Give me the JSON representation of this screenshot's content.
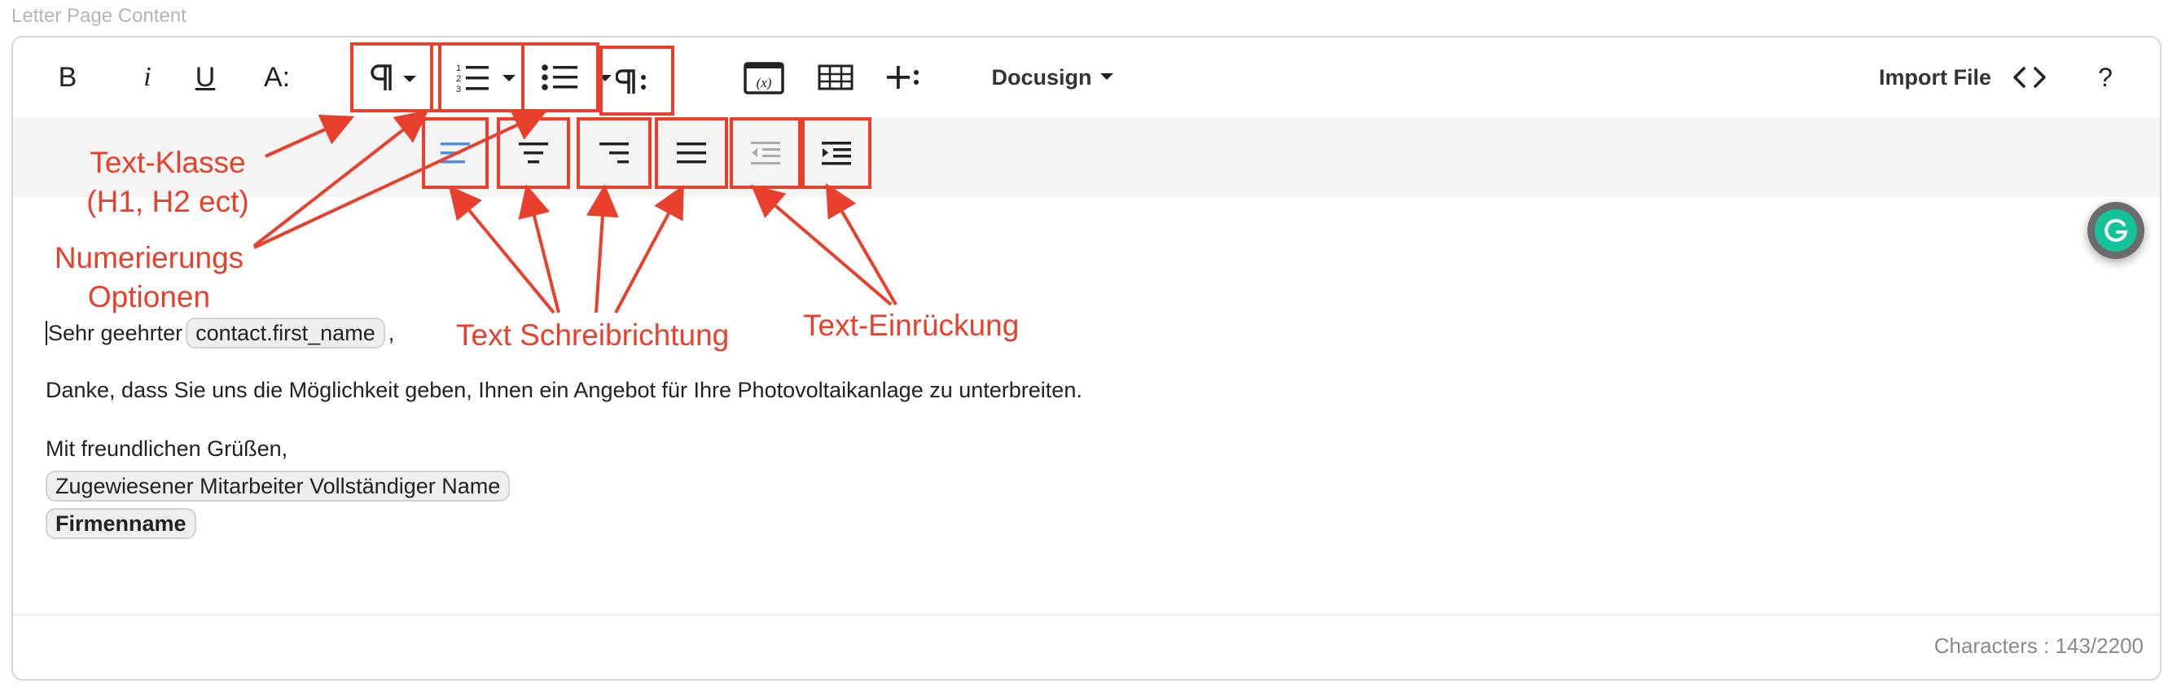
{
  "field": {
    "label": "Letter Page Content"
  },
  "toolbar": {
    "bold": "B",
    "italic": "i",
    "underline": "U",
    "font_size": "A:",
    "docusign": "Docusign",
    "import_file": "Import File",
    "help": "?"
  },
  "body": {
    "greeting": "Sehr geehrter",
    "greeting_var": "contact.first_name",
    "greeting_suffix": ",",
    "paragraph": "Danke, dass Sie uns die Möglichkeit geben, Ihnen ein Angebot für Ihre Photovoltaikanlage zu unterbreiten.",
    "closing": "Mit freundlichen Grüßen,",
    "employee_var": "Zugewiesener Mitarbeiter Vollständiger Name",
    "company_var": "Firmenname"
  },
  "footer": {
    "characters": "Characters : 143/2200"
  },
  "annotations": {
    "text_class_1": "Text-Klasse",
    "text_class_2": "(H1, H2 ect)",
    "numbering_1": "Numerierungs",
    "numbering_2": "Optionen",
    "writing_direction": "Text Schreibrichtung",
    "indent": "Text-Einrückung"
  },
  "colors": {
    "annotation_red": "#e8402c",
    "align_active_blue": "#4a8fe0",
    "grammarly_green": "#15c39a"
  }
}
